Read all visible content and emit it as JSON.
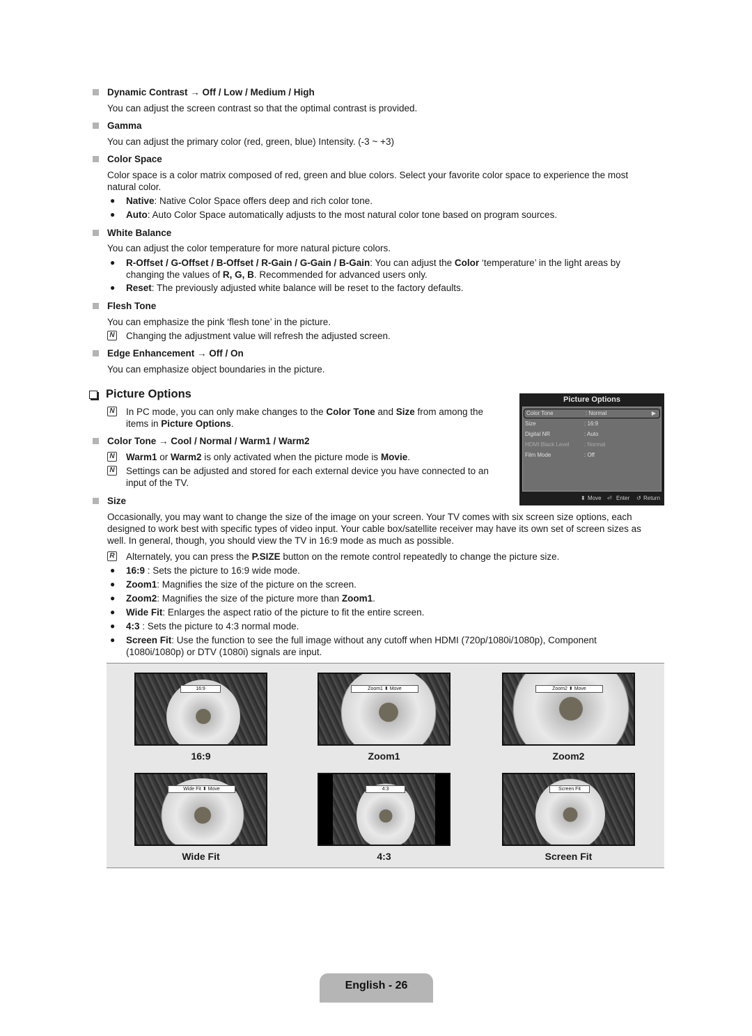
{
  "items": [
    {
      "title": "Dynamic Contrast → Off / Low / Medium / High",
      "desc": "You can adjust the screen contrast so that the optimal contrast is provided."
    },
    {
      "title": "Gamma",
      "desc": "You can adjust the primary color (red, green, blue) Intensity. (-3 ~ +3)"
    },
    {
      "title": "Color Space",
      "desc": "Color space is a color matrix composed of red, green and blue colors. Select your favorite color space to experience the most natural color.",
      "bullets": [
        {
          "term": "Native",
          "text": ": Native Color Space offers deep and rich color tone."
        },
        {
          "term": "Auto",
          "text": ": Auto Color Space automatically adjusts to the most natural color tone based on program sources."
        }
      ]
    },
    {
      "title": "White Balance",
      "desc": "You can adjust the color temperature for more natural picture colors.",
      "bullets": [
        {
          "term": "R-Offset / G-Offset / B-Offset / R-Gain / G-Gain / B-Gain",
          "text_a": ": You can adjust the ",
          "term2": "Color",
          "text_b": " ‘temperature’ in the light areas by changing the values of ",
          "term3": "R, G, B",
          "text_c": ". Recommended for advanced users only."
        },
        {
          "term": "Reset",
          "text": ": The previously adjusted white balance will be reset to the factory defaults."
        }
      ]
    },
    {
      "title": "Flesh Tone",
      "desc": "You can emphasize the pink ‘flesh tone’ in the picture.",
      "note": "Changing the adjustment value will refresh the adjusted screen."
    },
    {
      "title": "Edge Enhancement → Off / On",
      "desc": "You can emphasize object boundaries in the picture."
    }
  ],
  "picture_options": {
    "title": "Picture Options",
    "note1": {
      "a": "In PC mode, you can only make changes to the ",
      "b": "Color Tone",
      "c": " and ",
      "d": "Size",
      "e": " from among the items in ",
      "f": "Picture Options",
      "g": "."
    },
    "color_tone_title": "Color Tone → Cool / Normal / Warm1 / Warm2",
    "note2": {
      "a": "Warm1",
      "b": " or ",
      "c": "Warm2",
      "d": " is only activated when the picture mode is ",
      "e": "Movie",
      "f": "."
    },
    "note3": "Settings can be adjusted and stored for each external device you have connected to an input of the TV.",
    "size_title": "Size",
    "size_desc": "Occasionally, you may want to change the size of the image on your screen. Your TV comes with six screen size options, each designed to work best with specific types of video input. Your cable box/satellite receiver may have its own set of screen sizes as well. In general, though, you should view the TV in 16:9 mode as much as possible.",
    "remote_note": {
      "a": "Alternately, you can press the ",
      "b": "P.SIZE",
      "c": " button on the remote control repeatedly to change the picture size."
    },
    "size_bullets": [
      {
        "term": "16:9",
        "text": " : Sets the picture to 16:9 wide mode."
      },
      {
        "term": "Zoom1",
        "text": ": Magnifies the size of the picture on the screen."
      },
      {
        "term": "Zoom2",
        "text": ": Magnifies the size of the picture more than ",
        "term_end": "Zoom1",
        "end": "."
      },
      {
        "term": "Wide Fit",
        "text": ": Enlarges the aspect ratio of the picture to fit the entire screen."
      },
      {
        "term": "4:3",
        "text": " : Sets the picture to 4:3 normal mode."
      },
      {
        "term": "Screen Fit",
        "text": ": Use the function to see the full image without any cutoff when HDMI (720p/1080i/1080p), Component (1080i/1080p) or DTV (1080i) signals are input."
      }
    ]
  },
  "osd": {
    "title": "Picture Options",
    "rows": [
      {
        "label": "Color Tone",
        "value": ": Normal",
        "selected": true
      },
      {
        "label": "Size",
        "value": ": 16:9"
      },
      {
        "label": "Digital NR",
        "value": ": Auto"
      },
      {
        "label": "HDMI Black Level",
        "value": ": Normal",
        "dim": true
      },
      {
        "label": "Film Mode",
        "value": ": Off"
      }
    ],
    "footer": {
      "move": "Move",
      "enter": "Enter",
      "return": "Return"
    },
    "icons": {
      "move": "up-down-arrow-icon",
      "enter": "enter-icon",
      "return": "return-icon",
      "arrow": "right-triangle-icon"
    }
  },
  "gallery": [
    {
      "caption": "16:9",
      "osd_label": "16:9"
    },
    {
      "caption": "Zoom1",
      "osd_label": "Zoom1 ⬍ Move"
    },
    {
      "caption": "Zoom2",
      "osd_label": "Zoom2 ⬍ Move"
    },
    {
      "caption": "Wide Fit",
      "osd_label": "Wide Fit ⬍ Move"
    },
    {
      "caption": "4:3",
      "osd_label": "4:3"
    },
    {
      "caption": "Screen Fit",
      "osd_label": "Screen Fit"
    }
  ],
  "footer": {
    "page_label": "English - 26"
  }
}
